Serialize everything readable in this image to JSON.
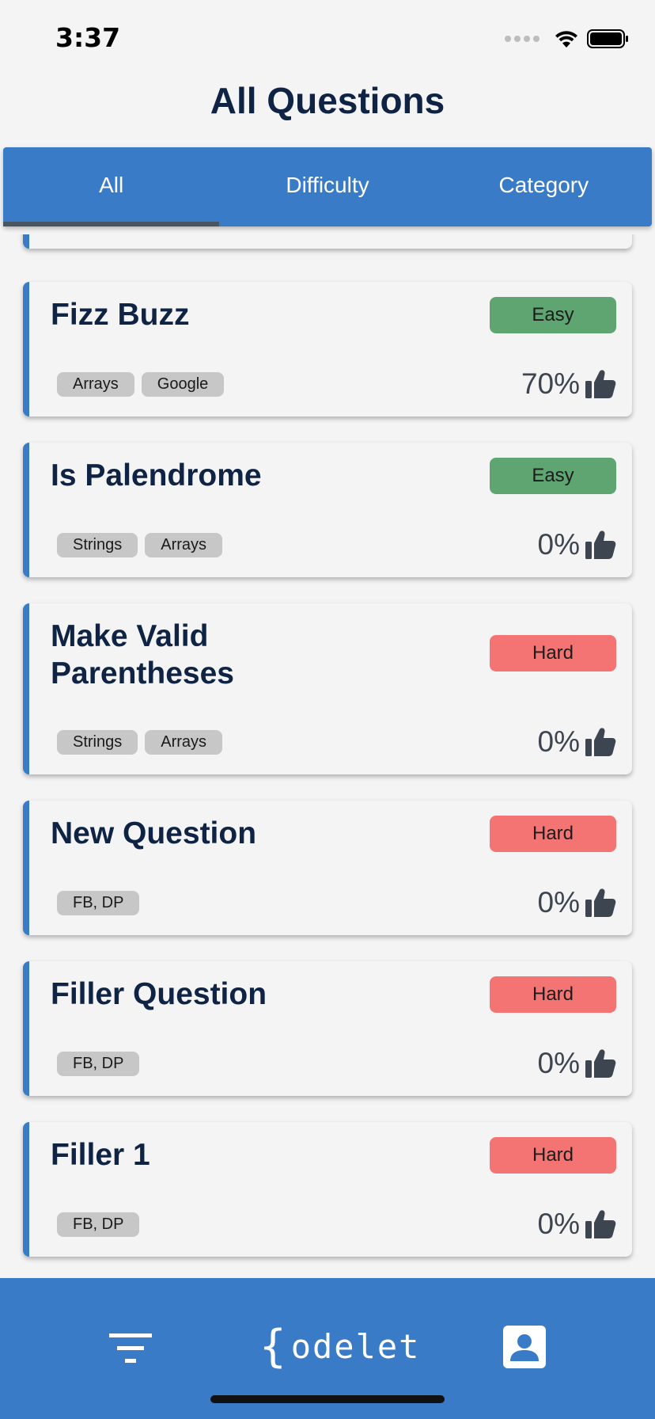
{
  "status_bar": {
    "time": "3:37"
  },
  "header": {
    "title": "All Questions"
  },
  "tabs": [
    {
      "label": "All",
      "active": true
    },
    {
      "label": "Difficulty",
      "active": false
    },
    {
      "label": "Category",
      "active": false
    }
  ],
  "questions": [
    {
      "title": "Fizz Buzz",
      "difficulty": "Easy",
      "tags": [
        "Arrays",
        "Google"
      ],
      "likes": "70%"
    },
    {
      "title": "Is Palendrome",
      "difficulty": "Easy",
      "tags": [
        "Strings",
        "Arrays"
      ],
      "likes": "0%"
    },
    {
      "title": "Make Valid Parentheses",
      "difficulty": "Hard",
      "tags": [
        "Strings",
        "Arrays"
      ],
      "likes": "0%"
    },
    {
      "title": "New Question",
      "difficulty": "Hard",
      "tags": [
        "FB, DP"
      ],
      "likes": "0%"
    },
    {
      "title": "Filler Question",
      "difficulty": "Hard",
      "tags": [
        "FB, DP"
      ],
      "likes": "0%"
    },
    {
      "title": "Filler 1",
      "difficulty": "Hard",
      "tags": [
        "FB, DP"
      ],
      "likes": "0%"
    }
  ],
  "bottom_nav": {
    "logo_text": "odelet",
    "logo_brace": "{",
    "filter_icon": "filter-icon",
    "profile_icon": "profile-icon"
  },
  "colors": {
    "primary": "#3a7bc7",
    "easy": "#5ea572",
    "hard": "#f47474",
    "title_text": "#0f2444"
  }
}
